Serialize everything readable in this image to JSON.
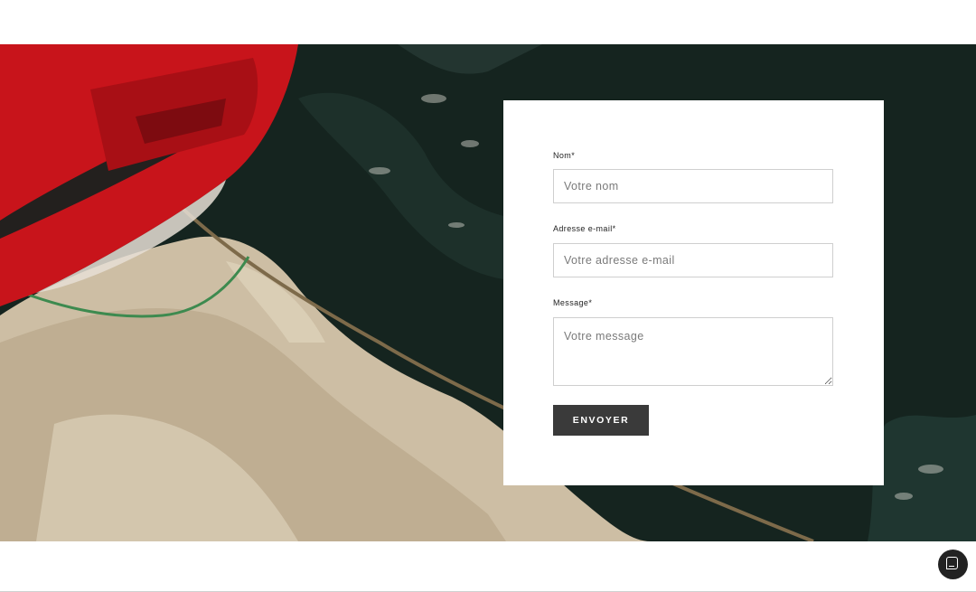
{
  "form": {
    "name_label": "Nom*",
    "name_placeholder": "Votre nom",
    "email_label": "Adresse e-mail*",
    "email_placeholder": "Votre adresse e-mail",
    "message_label": "Message*",
    "message_placeholder": "Votre message",
    "submit_label": "ENVOYER"
  },
  "chat": {
    "icon": "chat-bubble-icon"
  },
  "colors": {
    "button_bg": "#3a3a3a",
    "water_dark": "#15241f",
    "foam": "#cdbea4",
    "boat_red": "#c8141b"
  }
}
